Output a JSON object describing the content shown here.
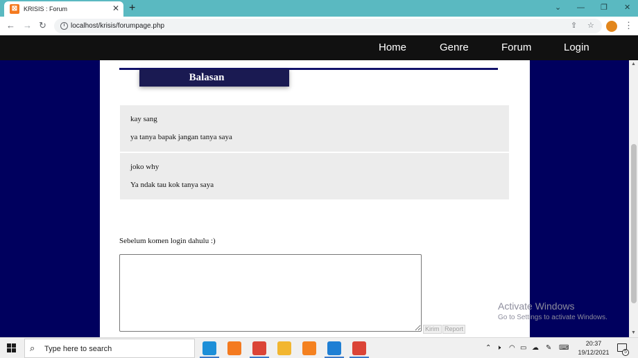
{
  "browser": {
    "tab_title": "KRISIS : Forum",
    "tab_close": "✕",
    "new_tab": "+",
    "url": "localhost/krisis/forumpage.php",
    "window_controls": [
      "⌄",
      "—",
      "❐",
      "✕"
    ]
  },
  "site_nav": {
    "items": [
      {
        "label": "Home"
      },
      {
        "label": "Genre"
      },
      {
        "label": "Forum"
      },
      {
        "label": "Login"
      }
    ]
  },
  "forum": {
    "heading": "Balasan",
    "replies": [
      {
        "author": "kay sang",
        "body": "ya tanya bapak jangan tanya saya"
      },
      {
        "author": "joko why",
        "body": "Ya ndak tau kok tanya saya"
      }
    ],
    "login_note": "Sebelum komen login dahulu :)",
    "comment_placeholder": "",
    "buttons": {
      "submit": "Kirim",
      "report": "Report"
    }
  },
  "watermark": {
    "title": "Activate Windows",
    "subtitle": "Go to Settings to activate Windows."
  },
  "taskbar": {
    "search_placeholder": "Type here to search",
    "apps": [
      {
        "icon": "edge-icon",
        "color": "#1d8fd8"
      },
      {
        "icon": "xampp-icon",
        "color": "#f47a1f"
      },
      {
        "icon": "chrome-icon",
        "color": "#db4437"
      },
      {
        "icon": "file-explorer-icon",
        "color": "#f2b630"
      },
      {
        "icon": "cloud-icon",
        "color": "#f48120"
      },
      {
        "icon": "vscode-icon",
        "color": "#1f7fd4"
      },
      {
        "icon": "chrome-icon",
        "color": "#db4437"
      }
    ],
    "time": "20:37",
    "date": "19/12/2021",
    "notification_count": "5"
  }
}
